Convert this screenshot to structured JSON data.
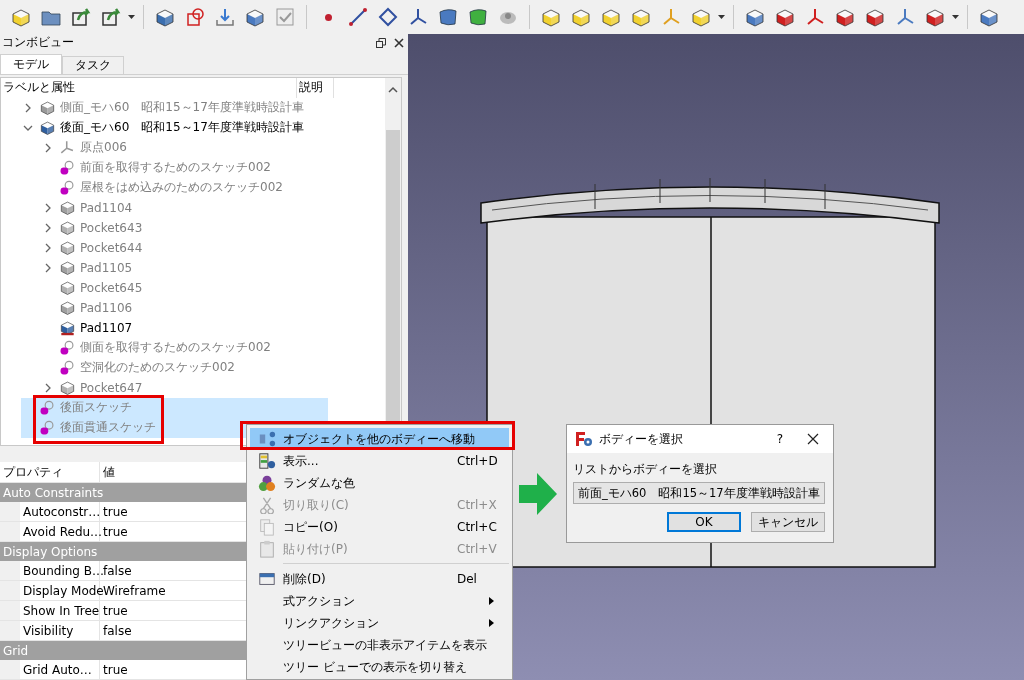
{
  "panel": {
    "title": "コンボビュー"
  },
  "tabs": [
    {
      "label": "モデル",
      "selected": true
    },
    {
      "label": "タスク",
      "selected": false
    }
  ],
  "tree": {
    "columns": [
      "ラベルと属性",
      "説明"
    ],
    "items": [
      {
        "label": "側面_モハ60　昭和15～17年度準戦時設計車",
        "kind": "body",
        "visible": false,
        "expanded": false,
        "selected": false
      },
      {
        "label": "後面_モハ60　昭和15～17年度準戦時設計車",
        "kind": "body",
        "visible": true,
        "expanded": true,
        "selected": false,
        "children": [
          {
            "label": "原点006",
            "kind": "origin",
            "visible": false,
            "expanded": false,
            "selected": false
          },
          {
            "label": "前面を取得するためのスケッチ002",
            "kind": "sketch",
            "visible": false,
            "selected": false
          },
          {
            "label": "屋根をはめ込みのためのスケッチ002",
            "kind": "sketch",
            "visible": false,
            "selected": false
          },
          {
            "label": "Pad1104",
            "kind": "pad",
            "visible": false,
            "expanded": false,
            "selected": false
          },
          {
            "label": "Pocket643",
            "kind": "pocket",
            "visible": false,
            "expanded": false,
            "selected": false
          },
          {
            "label": "Pocket644",
            "kind": "pocket",
            "visible": false,
            "expanded": false,
            "selected": false
          },
          {
            "label": "Pad1105",
            "kind": "pad",
            "visible": false,
            "expanded": false,
            "selected": false
          },
          {
            "label": "Pocket645",
            "kind": "pocket",
            "visible": false,
            "selected": false
          },
          {
            "label": "Pad1106",
            "kind": "pad",
            "visible": false,
            "selected": false
          },
          {
            "label": "Pad1107",
            "kind": "pad",
            "visible": true,
            "selected": false
          },
          {
            "label": "側面を取得するためのスケッチ002",
            "kind": "sketch",
            "visible": false,
            "selected": false
          },
          {
            "label": "空洞化のためのスケッチ002",
            "kind": "sketch",
            "visible": false,
            "selected": false
          },
          {
            "label": "Pocket647",
            "kind": "pocket",
            "visible": false,
            "expanded": false,
            "selected": false
          }
        ]
      },
      {
        "label": "後面スケッチ",
        "kind": "sketch",
        "visible": false,
        "selected": true
      },
      {
        "label": "後面貫通スケッチ",
        "kind": "sketch",
        "visible": false,
        "selected": true
      }
    ]
  },
  "properties": {
    "columns": [
      "プロパティ",
      "値"
    ],
    "groups": [
      {
        "name": "Auto Constraints",
        "rows": [
          {
            "name": "Autoconstr…",
            "value": "true"
          },
          {
            "name": "Avoid Redu…",
            "value": "true"
          }
        ]
      },
      {
        "name": "Display Options",
        "rows": [
          {
            "name": "Bounding B…",
            "value": "false"
          },
          {
            "name": "Display Mode",
            "value": "Wireframe"
          },
          {
            "name": "Show In Tree",
            "value": "true"
          },
          {
            "name": "Visibility",
            "value": "false"
          }
        ]
      },
      {
        "name": "Grid",
        "rows": [
          {
            "name": "Grid Auto…",
            "value": "true"
          }
        ]
      }
    ]
  },
  "context_menu": {
    "items": [
      {
        "kind": "item",
        "label": "オブジェクトを他のボディーへ移動",
        "selected": true,
        "disabled": false
      },
      {
        "kind": "item",
        "label": "表示...",
        "shortcut": "Ctrl+D",
        "selected": false,
        "disabled": false
      },
      {
        "kind": "item",
        "label": "ランダムな色",
        "selected": false,
        "disabled": false
      },
      {
        "kind": "item",
        "label": "切り取り(C)",
        "shortcut": "Ctrl+X",
        "selected": false,
        "disabled": true
      },
      {
        "kind": "item",
        "label": "コピー(O)",
        "shortcut": "Ctrl+C",
        "selected": false,
        "disabled": false
      },
      {
        "kind": "item",
        "label": "貼り付け(P)",
        "shortcut": "Ctrl+V",
        "selected": false,
        "disabled": true
      },
      {
        "kind": "separator"
      },
      {
        "kind": "item",
        "label": "削除(D)",
        "shortcut": "Del",
        "selected": false,
        "disabled": false
      },
      {
        "kind": "submenu",
        "label": "式アクション",
        "selected": false,
        "disabled": false
      },
      {
        "kind": "submenu",
        "label": "リンクアクション",
        "selected": false,
        "disabled": false
      },
      {
        "kind": "item",
        "label": "ツリービューの非表示アイテムを表示",
        "selected": false,
        "disabled": false
      },
      {
        "kind": "item",
        "label": "ツリー ビューでの表示を切り替え",
        "selected": false,
        "disabled": false
      }
    ]
  },
  "dialog": {
    "title": "ボディーを選択",
    "help": "?",
    "label": "リストからボディーを選択",
    "value": "前面_モハ60　昭和15～17年度準戦時設計車",
    "buttons": [
      {
        "label": "OK",
        "default": true
      },
      {
        "label": "キャンセル",
        "default": false
      }
    ]
  }
}
